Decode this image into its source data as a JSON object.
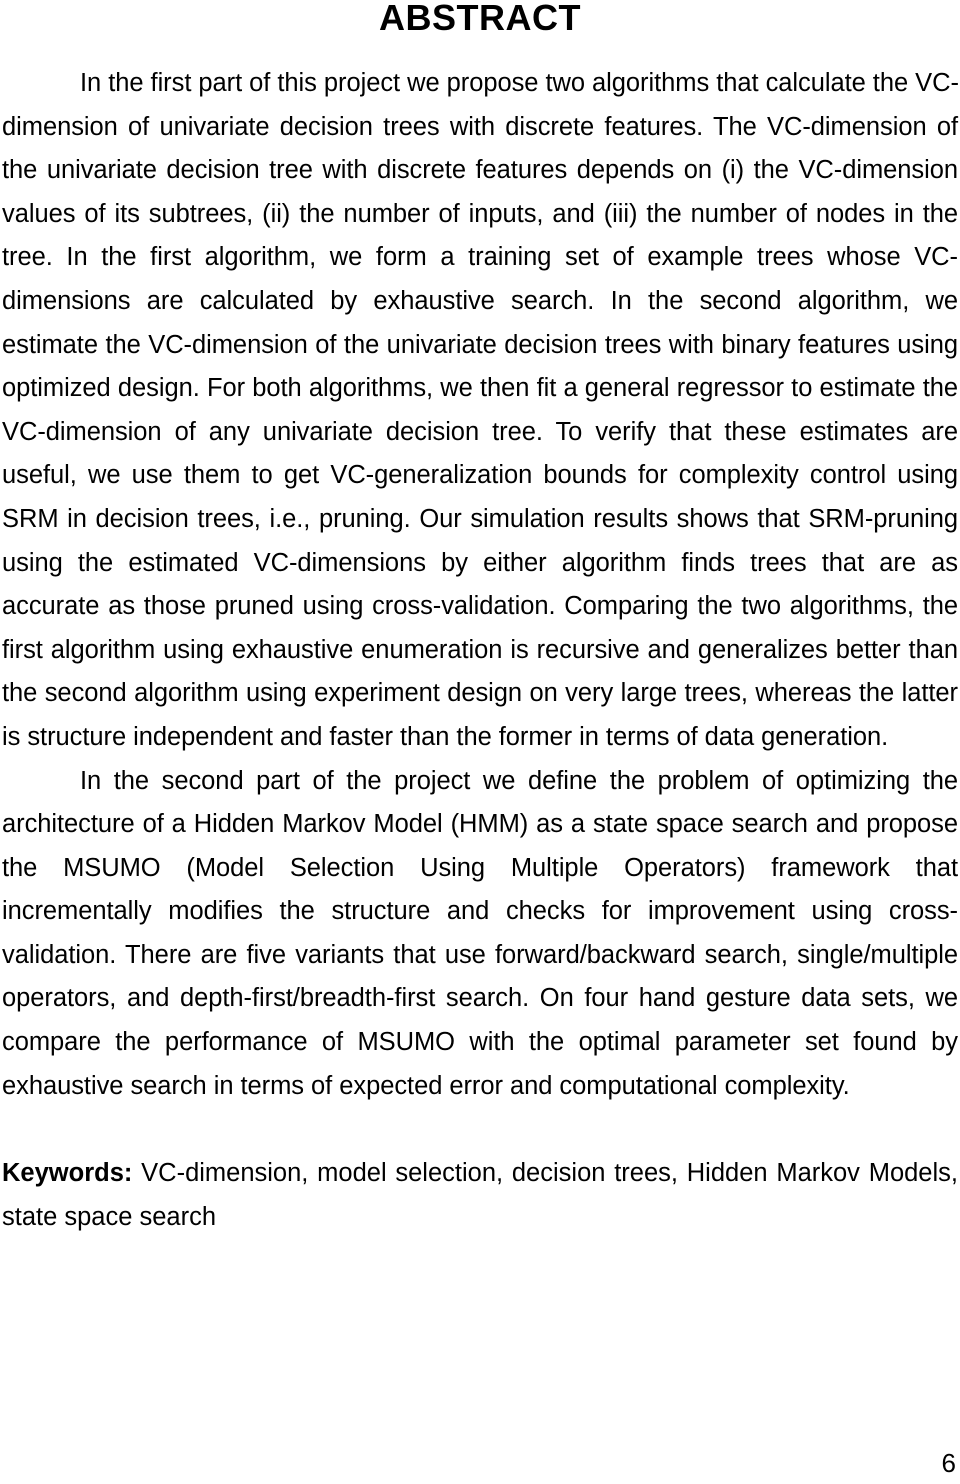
{
  "document": {
    "heading": "ABSTRACT",
    "page_number": "6"
  },
  "abstract": {
    "paragraph_1_lines": [
      "In the first part of this project we propose two algorithms that calculate the VC-",
      "dimension of univariate decision trees with discrete features. The VC-dimension of",
      "the univariate decision tree with discrete features depends on (i) the VC-dimension",
      "values of its subtrees, (ii) the number of inputs, and (iii) the number of nodes in the",
      "tree. In the first algorithm, we form a training set of example trees whose VC-",
      "dimensions are calculated by exhaustive search. In the second algorithm, we",
      "estimate the VC-dimension of the univariate decision trees with binary features using",
      "optimized design. For both algorithms, we then fit a general regressor to estimate the",
      "VC-dimension of any univariate decision tree. To verify that these estimates are",
      "useful, we use them to get VC-generalization bounds for complexity control using",
      "SRM in decision trees, i.e., pruning. Our simulation results shows that SRM-pruning",
      "using the estimated VC-dimensions by either algorithm finds trees that are as",
      "accurate as those pruned using cross-validation. Comparing the two algorithms, the",
      "first algorithm using exhaustive enumeration is recursive and generalizes better than",
      "the second algorithm using experiment design on very large trees, whereas the latter",
      "is structure independent and faster than the former in terms of data generation."
    ],
    "paragraph_2_lines": [
      "In the second part of the project we define the problem of optimizing the",
      "architecture of a Hidden Markov Model (HMM) as a state space search and propose",
      "the MSUMO (Model Selection Using Multiple Operators) framework that",
      "incrementally modifies the structure and checks for improvement using cross-",
      "validation. There are five variants that use forward/backward search, single/multiple",
      "operators, and depth-first/breadth-first search. On four hand gesture data sets, we",
      "compare the performance of MSUMO with the optimal parameter set found by",
      "exhaustive search in terms of expected error and computational complexity."
    ]
  },
  "keywords": {
    "label": "Keywords:",
    "line_1": " VC-dimension, model selection, decision trees, Hidden Markov Models,",
    "line_2": "state space search"
  }
}
